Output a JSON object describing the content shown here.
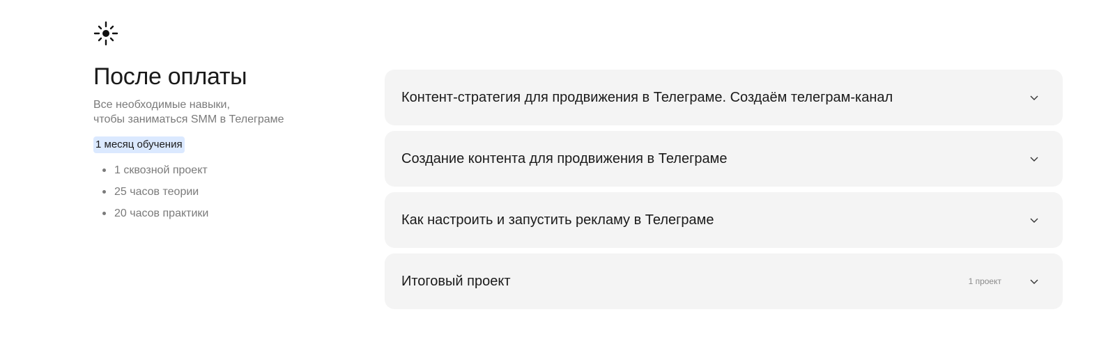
{
  "icons": {
    "hero": "sun-icon",
    "chevron": "chevron-down-icon"
  },
  "section": {
    "title": "После оплаты",
    "subtitle": "Все необходимые навыки,\nчтобы заниматься SMM в Телеграме",
    "badge": "1 месяц обучения",
    "badge_color": "#dbe9ff",
    "bullets": [
      "1 сквозной проект",
      "25 часов теории",
      "20 часов практики"
    ]
  },
  "modules": [
    {
      "title": "Контент-стратегия для продвижения в Телеграме. Создаём телеграм-канал",
      "meta": ""
    },
    {
      "title": "Создание контента для продвижения в Телеграме",
      "meta": ""
    },
    {
      "title": "Как настроить и запустить рекламу в Телеграме",
      "meta": ""
    },
    {
      "title": "Итоговый проект",
      "meta": "1 проект"
    }
  ],
  "colors": {
    "card_bg": "#f4f4f4",
    "muted_text": "#7a7a7a"
  }
}
